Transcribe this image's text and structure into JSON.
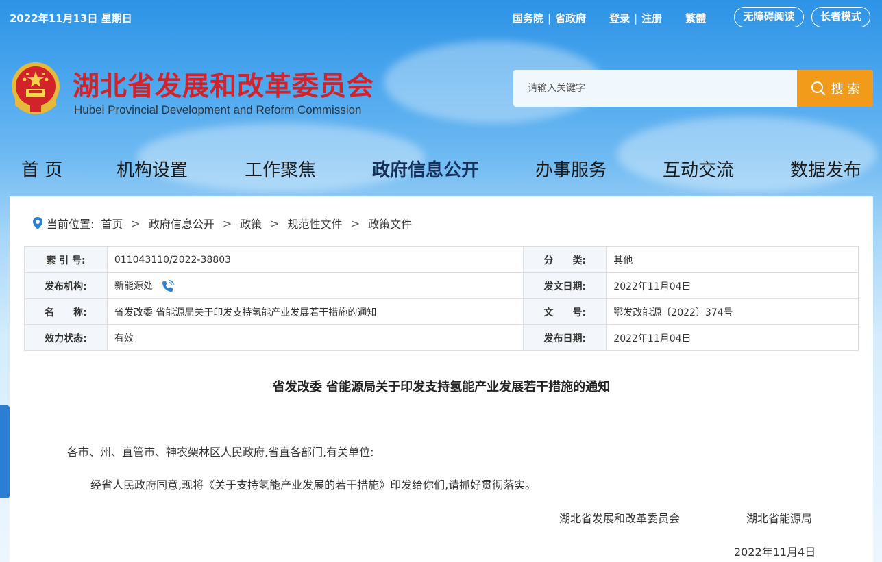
{
  "topbar": {
    "date": "2022年11月13日 星期日",
    "links": [
      "国务院",
      "省政府"
    ],
    "auth": [
      "登录",
      "注册"
    ],
    "traditional": "繁體",
    "accessible_reading": "无障碍阅读",
    "elder_mode": "长者模式"
  },
  "header": {
    "title_cn": "湖北省发展和改革委员会",
    "title_en": "Hubei Provincial Development and Reform Commission",
    "search_placeholder": "请输入关键字",
    "search_button": "搜 索"
  },
  "nav": {
    "items": [
      "首 页",
      "机构设置",
      "工作聚焦",
      "政府信息公开",
      "办事服务",
      "互动交流",
      "数据发布"
    ],
    "active": "政府信息公开"
  },
  "breadcrumb": {
    "label": "当前位置:",
    "items": [
      "首页",
      "政府信息公开",
      "政策",
      "规范性文件",
      "政策文件"
    ]
  },
  "meta": {
    "index_label": "索 引 号:",
    "index_value": "011043110/2022-38803",
    "category_label": "分　　类:",
    "category_value": "其他",
    "issuer_label": "发布机构:",
    "issuer_value": "新能源处",
    "issue_date_label": "发文日期:",
    "issue_date_value": "2022年11月04日",
    "name_label": "名　　称:",
    "name_value": "省发改委 省能源局关于印发支持氢能产业发展若干措施的通知",
    "doc_no_label": "文　　号:",
    "doc_no_value": "鄂发改能源〔2022〕374号",
    "status_label": "效力状态:",
    "status_value": "有效",
    "publish_date_label": "发布日期:",
    "publish_date_value": "2022年11月04日"
  },
  "document": {
    "title": "省发改委 省能源局关于印发支持氢能产业发展若干措施的通知",
    "salutation": "各市、州、直管市、神农架林区人民政府,省直各部门,有关单位:",
    "body": "经省人民政府同意,现将《关于支持氢能产业发展的若干措施》印发给你们,请抓好贯彻落实。",
    "signatory_1": "湖北省发展和改革委员会",
    "signatory_2": "湖北省能源局",
    "date": "2022年11月4日"
  },
  "colors": {
    "title_red": "#d2232a",
    "search_orange": "#f29b1b",
    "nav_active": "#15305a"
  }
}
